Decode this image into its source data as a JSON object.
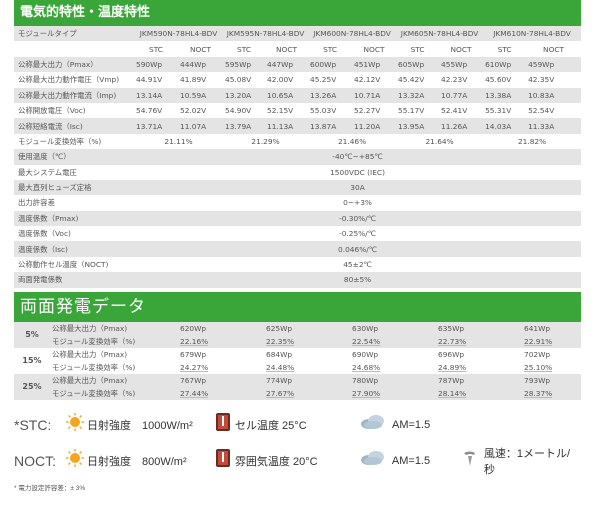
{
  "section1": {
    "title": "電気的特性・温度特性"
  },
  "header_label": "モジュールタイプ",
  "models": [
    "JKM590N-78HL4-BDV",
    "JKM595N-78HL4-BDV",
    "JKM600N-78HL4-BDV",
    "JKM605N-78HL4-BDV",
    "JKM610N-78HL4-BDV"
  ],
  "cond": {
    "stc": "STC",
    "noct": "NOCT"
  },
  "rows": [
    {
      "label": "公称最大出力（Pmax）",
      "v": [
        "590Wp",
        "444Wp",
        "595Wp",
        "447Wp",
        "600Wp",
        "451Wp",
        "605Wp",
        "455Wp",
        "610Wp",
        "459Wp"
      ]
    },
    {
      "label": "公称最大出力動作電圧（Vmp)",
      "v": [
        "44.91V",
        "41.89V",
        "45.08V",
        "42.00V",
        "45.25V",
        "42.12V",
        "45.42V",
        "42.23V",
        "45.60V",
        "42.35V"
      ]
    },
    {
      "label": "公称最大出力動作電流（Imp)",
      "v": [
        "13.14A",
        "10.59A",
        "13.20A",
        "10.65A",
        "13.26A",
        "10.71A",
        "13.32A",
        "10.77A",
        "13.38A",
        "10.83A"
      ]
    },
    {
      "label": "公称開放電圧（Voc)",
      "v": [
        "54.76V",
        "52.02V",
        "54.90V",
        "52.15V",
        "55.03V",
        "52.27V",
        "55.17V",
        "52.41V",
        "55.31V",
        "52.54V"
      ]
    },
    {
      "label": "公称短絡電流（Isc)",
      "v": [
        "13.71A",
        "11.07A",
        "13.79A",
        "11.13A",
        "13.87A",
        "11.20A",
        "13.95A",
        "11.26A",
        "14.03A",
        "11.33A"
      ]
    }
  ],
  "efficiency": {
    "label": "モジュール変換効率（%)",
    "v": [
      "21.11%",
      "21.29%",
      "21.46%",
      "21.64%",
      "21.82%"
    ]
  },
  "common_rows": [
    {
      "label": "使用温度（℃）",
      "value": "-40℃~+85℃"
    },
    {
      "label": "最大システム電圧",
      "value": "1500VDC (IEC)"
    },
    {
      "label": "最大直列ヒューズ定格",
      "value": "30A"
    },
    {
      "label": "出力許容差",
      "value": "0~+3%"
    },
    {
      "label": "温度係数（Pmax)",
      "value": "-0.30%/℃"
    },
    {
      "label": "温度係数（Voc)",
      "value": "-0.25%/℃"
    },
    {
      "label": "温度係数（Isc)",
      "value": "0.046%/℃"
    },
    {
      "label": "公称動作セル温度（NOCT)",
      "value": "45±2℃"
    },
    {
      "label": "両面発電係数",
      "value": "80±5%"
    }
  ],
  "section2": {
    "title": "両面発電データ"
  },
  "bifacial_labels": {
    "power": "公称最大出力（Pmax)",
    "eff": "モジュール変換効率（%)"
  },
  "bifacial": [
    {
      "pct": "5%",
      "power": [
        "620Wp",
        "625Wp",
        "630Wp",
        "635Wp",
        "641Wp"
      ],
      "eff": [
        "22.16%",
        "22.35%",
        "22.54%",
        "22.73%",
        "22.91%"
      ]
    },
    {
      "pct": "15%",
      "power": [
        "679Wp",
        "684Wp",
        "690Wp",
        "696Wp",
        "702Wp"
      ],
      "eff": [
        "24.27%",
        "24.48%",
        "24.68%",
        "24.89%",
        "25.10%"
      ]
    },
    {
      "pct": "25%",
      "power": [
        "767Wp",
        "774Wp",
        "780Wp",
        "787Wp",
        "793Wp"
      ],
      "eff": [
        "27.44%",
        "27.67%",
        "27.90%",
        "28.14%",
        "28.37%"
      ]
    }
  ],
  "legend": {
    "stc": {
      "head": "*STC:",
      "irr": "日射強度　1000W/m²",
      "temp": "セル温度 25°C",
      "am": "AM=1.5"
    },
    "noct": {
      "head": "NOCT:",
      "irr": "日射強度　800W/m²",
      "temp": "雰囲気温度 20°C",
      "am": "AM=1.5",
      "wind": "風速：1メートル/秒"
    },
    "note": "* 電力設定許容差：± 3%"
  },
  "colors": {
    "green": "#3aa63a",
    "row_gray": "#e4e4e4"
  }
}
